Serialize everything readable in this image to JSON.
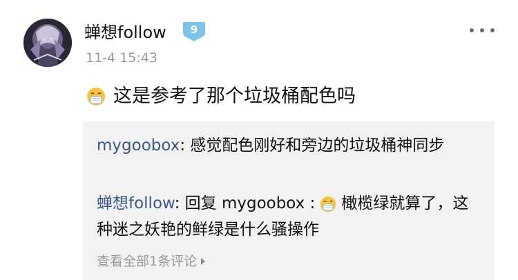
{
  "post": {
    "author": {
      "name": "蝉想follow",
      "level": "9",
      "avatar_icon": "anime-character-avatar"
    },
    "timestamp": "11-4 15:43",
    "text": "这是参考了那个垃圾桶配色吗",
    "emoji_icon": "sneeze-face-emoji"
  },
  "comments": [
    {
      "author": "mygoobox",
      "separator": ":",
      "text": "感觉配色刚好和旁边的垃圾桶神同步"
    },
    {
      "author": "蝉想follow",
      "separator": ":",
      "reply_prefix": "回复",
      "reply_target": "mygoobox :",
      "emoji_icon": "sneeze-face-emoji",
      "text": "橄榄绿就算了，这种迷之妖艳的鲜绿是什么骚操作"
    }
  ],
  "view_all_label": "查看全部1条评论",
  "colors": {
    "author_link": "#3b5a8a",
    "muted": "#9a9a9a",
    "badge": "#7fc3e6",
    "comments_bg": "#f2f2f2"
  }
}
